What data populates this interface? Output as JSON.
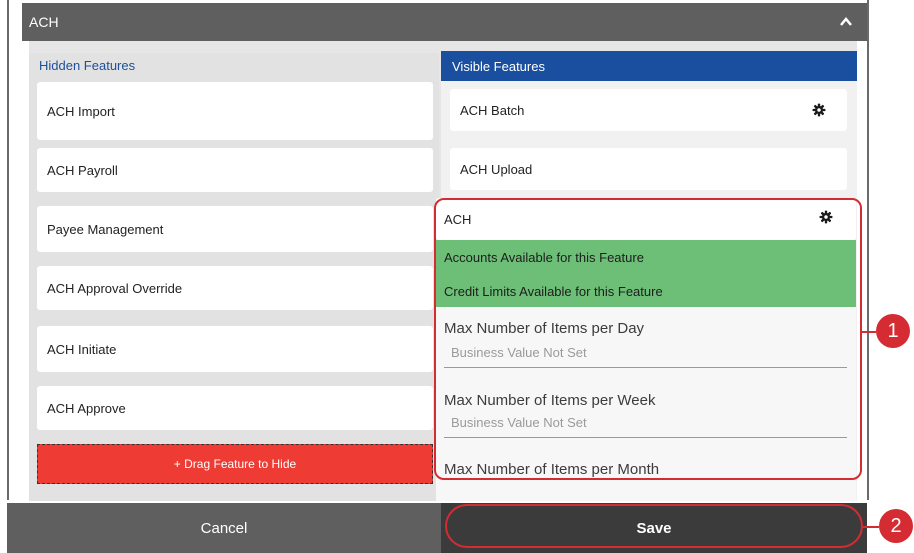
{
  "panel": {
    "title": "ACH",
    "collapse_icon": "chevron-up-icon"
  },
  "hidden": {
    "title": "Hidden Features",
    "items": [
      "ACH Import",
      "ACH Payroll",
      "Payee Management",
      "ACH Approval Override",
      "ACH Initiate",
      "ACH Approve"
    ],
    "drop_zone": "+ Drag Feature to Hide"
  },
  "visible": {
    "title": "Visible Features",
    "items": [
      "ACH Batch",
      "ACH Upload"
    ],
    "expanded": {
      "name": "ACH",
      "accounts_link": "Accounts Available for this Feature",
      "credit_link": "Credit Limits Available for this Feature",
      "settings": [
        {
          "label": "Max Number of Items per Day",
          "value": "Business Value Not Set"
        },
        {
          "label": "Max Number of Items per Week",
          "value": "Business Value Not Set"
        },
        {
          "label": "Max Number of Items per Month"
        }
      ]
    }
  },
  "footer": {
    "cancel": "Cancel",
    "save": "Save"
  },
  "callouts": [
    "1",
    "2"
  ],
  "colors": {
    "header": "#5f5f5f",
    "visible_header": "#1a4fa0",
    "drop_zone": "#ee3b33",
    "highlight": "#6dbf77",
    "callout": "#d42c32"
  }
}
